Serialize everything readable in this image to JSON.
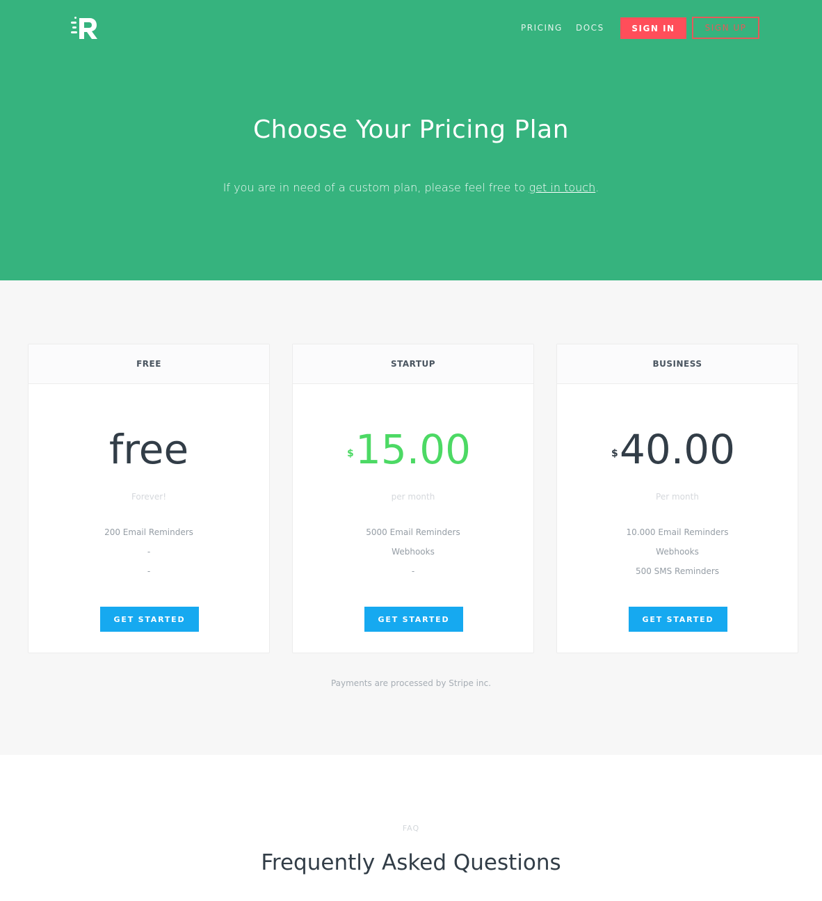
{
  "nav": {
    "pricing": "PRICING",
    "docs": "DOCS",
    "sign_in": "SIGN IN",
    "sign_up": "SIGN UP"
  },
  "hero": {
    "title": "Choose Your Pricing Plan",
    "subtitle_before": "If you are in need of a custom plan, please feel free to ",
    "subtitle_link": "get in touch",
    "subtitle_after": "."
  },
  "plans": [
    {
      "name": "FREE",
      "currency": "",
      "price": "free",
      "period": "Forever!",
      "features": [
        "200 Email Reminders",
        "-",
        "-"
      ],
      "cta": "GET STARTED"
    },
    {
      "name": "STARTUP",
      "currency": "$",
      "price": "15.00",
      "period": "per month",
      "features": [
        "5000 Email Reminders",
        "Webhooks",
        "-"
      ],
      "cta": "GET STARTED"
    },
    {
      "name": "BUSINESS",
      "currency": "$",
      "price": "40.00",
      "period": "Per month",
      "features": [
        "10.000 Email Reminders",
        "Webhooks",
        "500 SMS Reminders"
      ],
      "cta": "GET STARTED"
    }
  ],
  "payments_note": "Payments are processed by Stripe inc.",
  "faq": {
    "label": "FAQ",
    "title": "Frequently Asked Questions"
  },
  "colors": {
    "hero_bg": "#36b37e",
    "sign_in_bg": "#ff4e5a",
    "cta_bg": "#16a9f0",
    "startup_price": "#4cd964"
  }
}
